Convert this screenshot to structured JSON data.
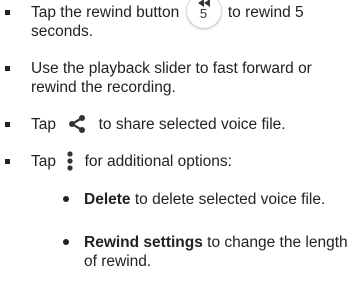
{
  "items": [
    {
      "parts": [
        "Tap the rewind button",
        "to rewind 5 seconds."
      ]
    },
    {
      "text": "Use the playback slider to fast forward or rewind the recording."
    },
    {
      "parts": [
        "Tap",
        "to share selected voice file."
      ]
    },
    {
      "parts": [
        "Tap",
        "for additional options:"
      ]
    }
  ],
  "sub_items": [
    {
      "bold": "Delete",
      "rest": " to delete selected voice file."
    },
    {
      "bold": "Rewind settings",
      "rest": " to change the length of rewind."
    }
  ],
  "icons": {
    "rewind": {
      "name": "rewind-5-icon",
      "label": "5"
    },
    "share": "share-icon",
    "more": "more-options-icon"
  }
}
